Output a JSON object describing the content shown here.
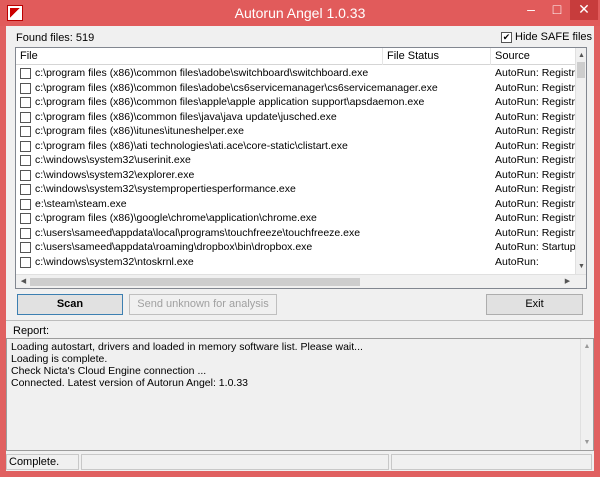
{
  "window": {
    "title": "Autorun Angel 1.0.33",
    "title_color": "#e15b5b",
    "controls": {
      "minimize": "–",
      "maximize": "□",
      "close": "✕"
    }
  },
  "toolbar": {
    "found_label": "Found files: 519",
    "hide_safe_label": "Hide SAFE files",
    "hide_safe_checked": true
  },
  "list": {
    "columns": [
      "File",
      "File Status",
      "Source"
    ],
    "rows": [
      {
        "path": "c:\\program files (x86)\\common files\\adobe\\switchboard\\switchboard.exe",
        "status": "",
        "source": "AutoRun: Registry"
      },
      {
        "path": "c:\\program files (x86)\\common files\\adobe\\cs6servicemanager\\cs6servicemanager.exe",
        "status": "",
        "source": "AutoRun: Registry"
      },
      {
        "path": "c:\\program files (x86)\\common files\\apple\\apple application support\\apsdaemon.exe",
        "status": "",
        "source": "AutoRun: Registry"
      },
      {
        "path": "c:\\program files (x86)\\common files\\java\\java update\\jusched.exe",
        "status": "",
        "source": "AutoRun: Registry"
      },
      {
        "path": "c:\\program files (x86)\\itunes\\ituneshelper.exe",
        "status": "",
        "source": "AutoRun: Registry"
      },
      {
        "path": "c:\\program files (x86)\\ati technologies\\ati.ace\\core-static\\clistart.exe",
        "status": "",
        "source": "AutoRun: Registry"
      },
      {
        "path": "c:\\windows\\system32\\userinit.exe",
        "status": "",
        "source": "AutoRun: Registry"
      },
      {
        "path": "c:\\windows\\system32\\explorer.exe",
        "status": "",
        "source": "AutoRun: Registry"
      },
      {
        "path": "c:\\windows\\system32\\systempropertiesperformance.exe",
        "status": "",
        "source": "AutoRun: Registry"
      },
      {
        "path": "e:\\steam\\steam.exe",
        "status": "",
        "source": "AutoRun: Registry"
      },
      {
        "path": "c:\\program files (x86)\\google\\chrome\\application\\chrome.exe",
        "status": "",
        "source": "AutoRun: Registry"
      },
      {
        "path": "c:\\users\\sameed\\appdata\\local\\programs\\touchfreeze\\touchfreeze.exe",
        "status": "",
        "source": "AutoRun: Registry"
      },
      {
        "path": "c:\\users\\sameed\\appdata\\roaming\\dropbox\\bin\\dropbox.exe",
        "status": "",
        "source": "AutoRun: Startup f"
      },
      {
        "path": "c:\\windows\\system32\\ntoskrnl.exe",
        "status": "",
        "source": "AutoRun:"
      }
    ]
  },
  "buttons": {
    "scan": "Scan",
    "send": "Send unknown for analysis",
    "exit": "Exit"
  },
  "report": {
    "label": "Report:",
    "lines": [
      "Loading autostart, drivers and loaded in memory software list. Please wait...",
      "Loading is complete.",
      "Check Nicta's Cloud Engine connection ...",
      "Connected. Latest version of Autorun Angel: 1.0.33"
    ]
  },
  "status": {
    "main": "Complete."
  }
}
